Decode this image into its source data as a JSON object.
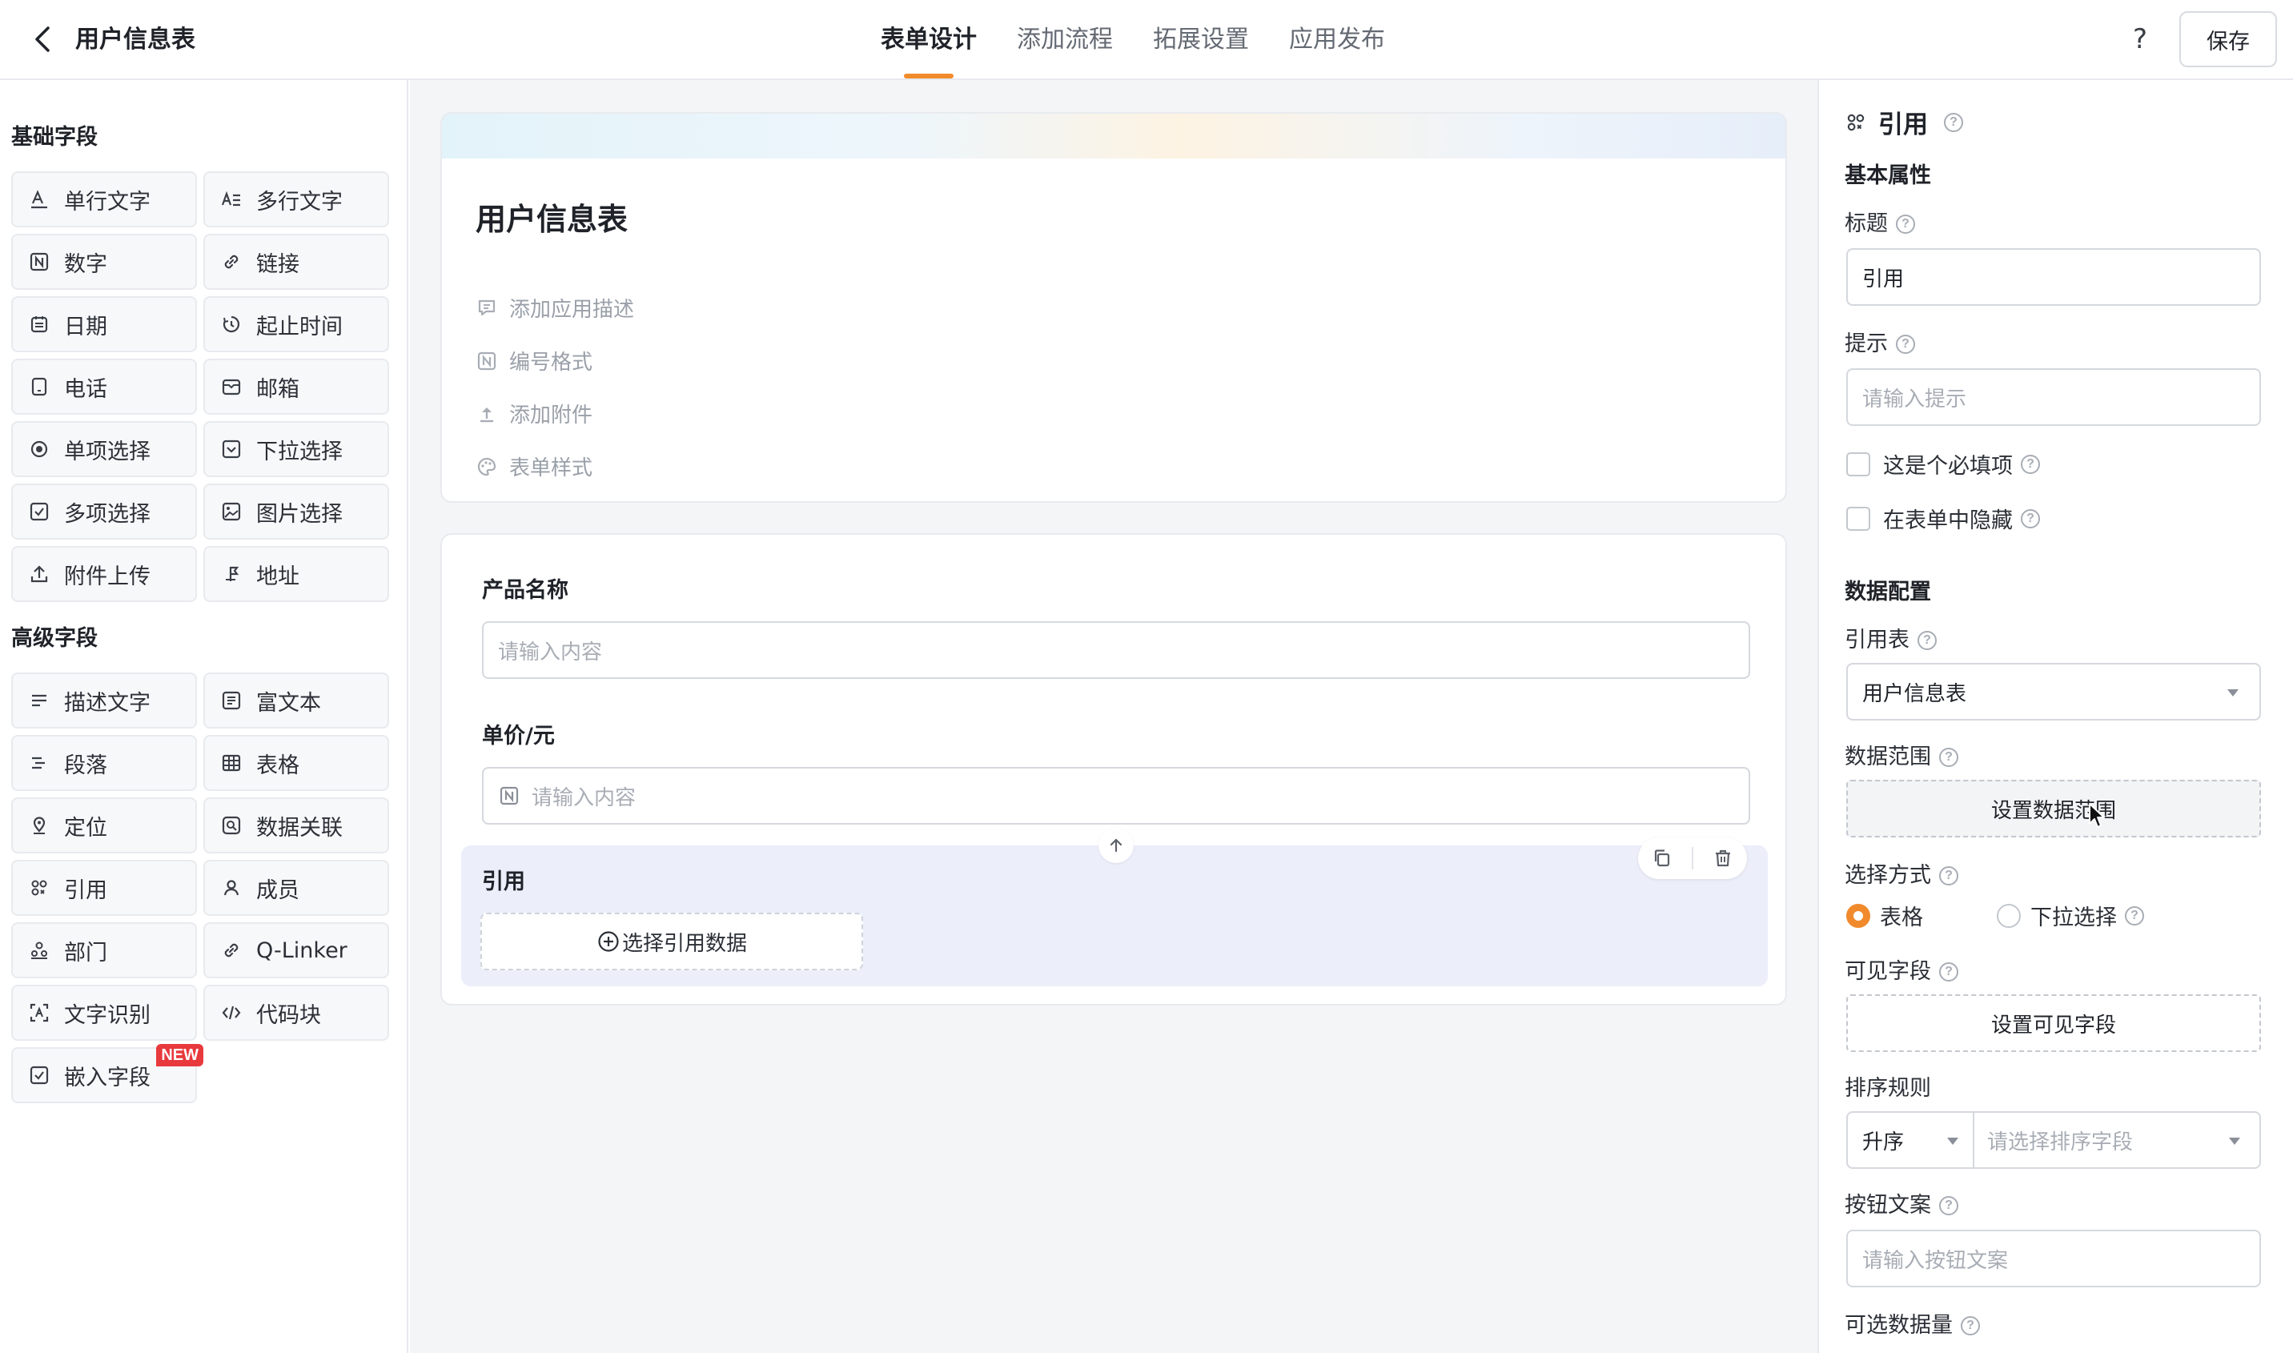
{
  "header": {
    "back_icon": "chevron-left-icon",
    "title": "用户信息表",
    "tabs": [
      {
        "label": "表单设计",
        "active": true
      },
      {
        "label": "添加流程",
        "active": false
      },
      {
        "label": "拓展设置",
        "active": false
      },
      {
        "label": "应用发布",
        "active": false
      }
    ],
    "help_label": "?",
    "save_label": "保存",
    "accent_color": "#f28b2c"
  },
  "left": {
    "basic_title": "基础字段",
    "basic_fields": [
      {
        "label": "单行文字",
        "icon": "single-line-text-icon"
      },
      {
        "label": "多行文字",
        "icon": "multi-line-text-icon"
      },
      {
        "label": "数字",
        "icon": "number-icon"
      },
      {
        "label": "链接",
        "icon": "link-icon"
      },
      {
        "label": "日期",
        "icon": "calendar-icon"
      },
      {
        "label": "起止时间",
        "icon": "time-range-icon"
      },
      {
        "label": "电话",
        "icon": "phone-icon"
      },
      {
        "label": "邮箱",
        "icon": "mail-icon"
      },
      {
        "label": "单项选择",
        "icon": "radio-icon"
      },
      {
        "label": "下拉选择",
        "icon": "dropdown-icon"
      },
      {
        "label": "多项选择",
        "icon": "checkbox-icon"
      },
      {
        "label": "图片选择",
        "icon": "image-icon"
      },
      {
        "label": "附件上传",
        "icon": "upload-icon"
      },
      {
        "label": "地址",
        "icon": "location-flag-icon"
      }
    ],
    "advanced_title": "高级字段",
    "advanced_fields": [
      {
        "label": "描述文字",
        "icon": "description-icon"
      },
      {
        "label": "富文本",
        "icon": "rich-text-icon"
      },
      {
        "label": "段落",
        "icon": "paragraph-icon"
      },
      {
        "label": "表格",
        "icon": "table-icon"
      },
      {
        "label": "定位",
        "icon": "pin-icon"
      },
      {
        "label": "数据关联",
        "icon": "data-link-icon"
      },
      {
        "label": "引用",
        "icon": "reference-icon"
      },
      {
        "label": "成员",
        "icon": "member-icon"
      },
      {
        "label": "部门",
        "icon": "department-icon"
      },
      {
        "label": "Q-Linker",
        "icon": "qlinker-icon"
      },
      {
        "label": "文字识别",
        "icon": "ocr-icon"
      },
      {
        "label": "代码块",
        "icon": "code-icon"
      },
      {
        "label": "嵌入字段",
        "icon": "embed-icon",
        "badge": "NEW"
      }
    ],
    "badge_color": "#e8393d"
  },
  "canvas": {
    "form_title": "用户信息表",
    "meta_actions": [
      {
        "label": "添加应用描述",
        "icon": "comment-icon"
      },
      {
        "label": "编号格式",
        "icon": "number-icon"
      },
      {
        "label": "添加附件",
        "icon": "upload-icon"
      },
      {
        "label": "表单样式",
        "icon": "palette-icon"
      }
    ],
    "questions": [
      {
        "label": "产品名称",
        "placeholder": "请输入内容"
      },
      {
        "label": "单价/元",
        "placeholder": "请输入内容",
        "icon": "number-icon"
      }
    ],
    "reference": {
      "label": "引用",
      "button": "选择引用数据"
    }
  },
  "props": {
    "header_icon": "reference-icon",
    "header_title": "引用",
    "basic_section": "基本属性",
    "title_label": "标题",
    "title_value": "引用",
    "hint_label": "提示",
    "hint_placeholder": "请输入提示",
    "required_label": "这是个必填项",
    "hidden_label": "在表单中隐藏",
    "data_section": "数据配置",
    "ref_table_label": "引用表",
    "ref_table_value": "用户信息表",
    "range_label": "数据范围",
    "range_button": "设置数据范围",
    "select_mode_label": "选择方式",
    "select_mode_options": [
      "表格",
      "下拉选择"
    ],
    "select_mode_selected": "表格",
    "visible_fields_label": "可见字段",
    "visible_fields_button": "设置可见字段",
    "sort_label": "排序规则",
    "sort_order": "升序",
    "sort_field_placeholder": "请选择排序字段",
    "button_text_label": "按钮文案",
    "button_text_placeholder": "请输入按钮文案",
    "max_count_label": "可选数据量"
  }
}
